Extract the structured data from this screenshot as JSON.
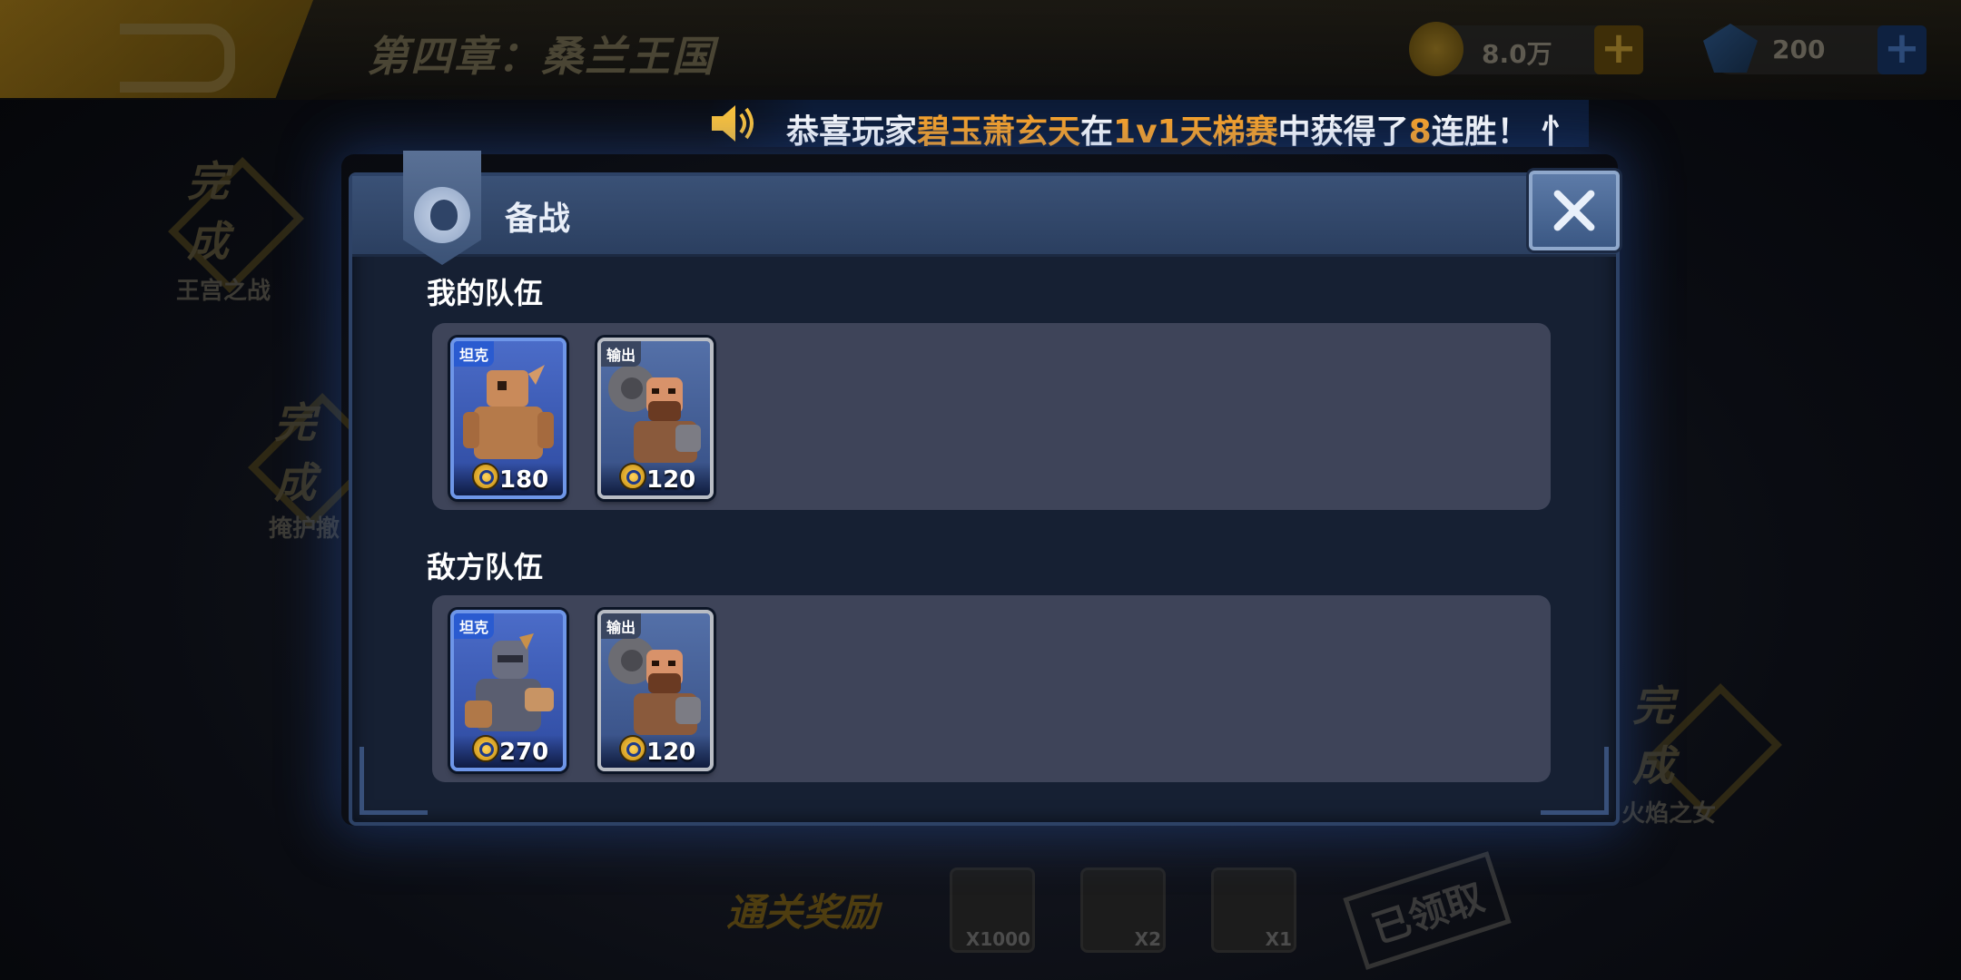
{
  "top": {
    "chapter_title": "第四章：桑兰王国",
    "gold_value": "8.0万",
    "gem_value": "200",
    "plus": "+"
  },
  "background_stages": [
    {
      "done": "完成",
      "label": "王宫之战"
    },
    {
      "done": "完成",
      "label": "掩护撤"
    },
    {
      "done": "完成",
      "label": "火焰之女"
    }
  ],
  "rewards": {
    "label": "通关奖励",
    "items": [
      {
        "icon": "gold-coin-icon",
        "qty": "X1000"
      },
      {
        "icon": "blue-card-icon",
        "qty": "X2"
      },
      {
        "icon": "purple-card-icon",
        "qty": "X1"
      }
    ],
    "claimed": "已领取"
  },
  "marquee": {
    "prefix": "恭喜玩家",
    "player": "碧玉萧玄天",
    "mid": "在",
    "mode": "1v1天梯赛",
    "mid2": "中获得了",
    "count": "8",
    "suffix": "连胜！ 忄"
  },
  "modal": {
    "title": "备战",
    "my_team_title": "我的队伍",
    "enemy_team_title": "敌方队伍",
    "my_team": [
      {
        "role": "坦克",
        "type": "tank",
        "cost": "180",
        "portrait": "stone-golem"
      },
      {
        "role": "输出",
        "type": "dps",
        "cost": "120",
        "portrait": "bearded-warrior"
      }
    ],
    "enemy_team": [
      {
        "role": "坦克",
        "type": "tank",
        "cost": "270",
        "portrait": "armored-knight"
      },
      {
        "role": "输出",
        "type": "dps",
        "cost": "120",
        "portrait": "bearded-warrior"
      }
    ]
  },
  "colors": {
    "highlight": "#ffa526",
    "modal_bg": "#162033",
    "panel_bg": "#3e4459"
  }
}
